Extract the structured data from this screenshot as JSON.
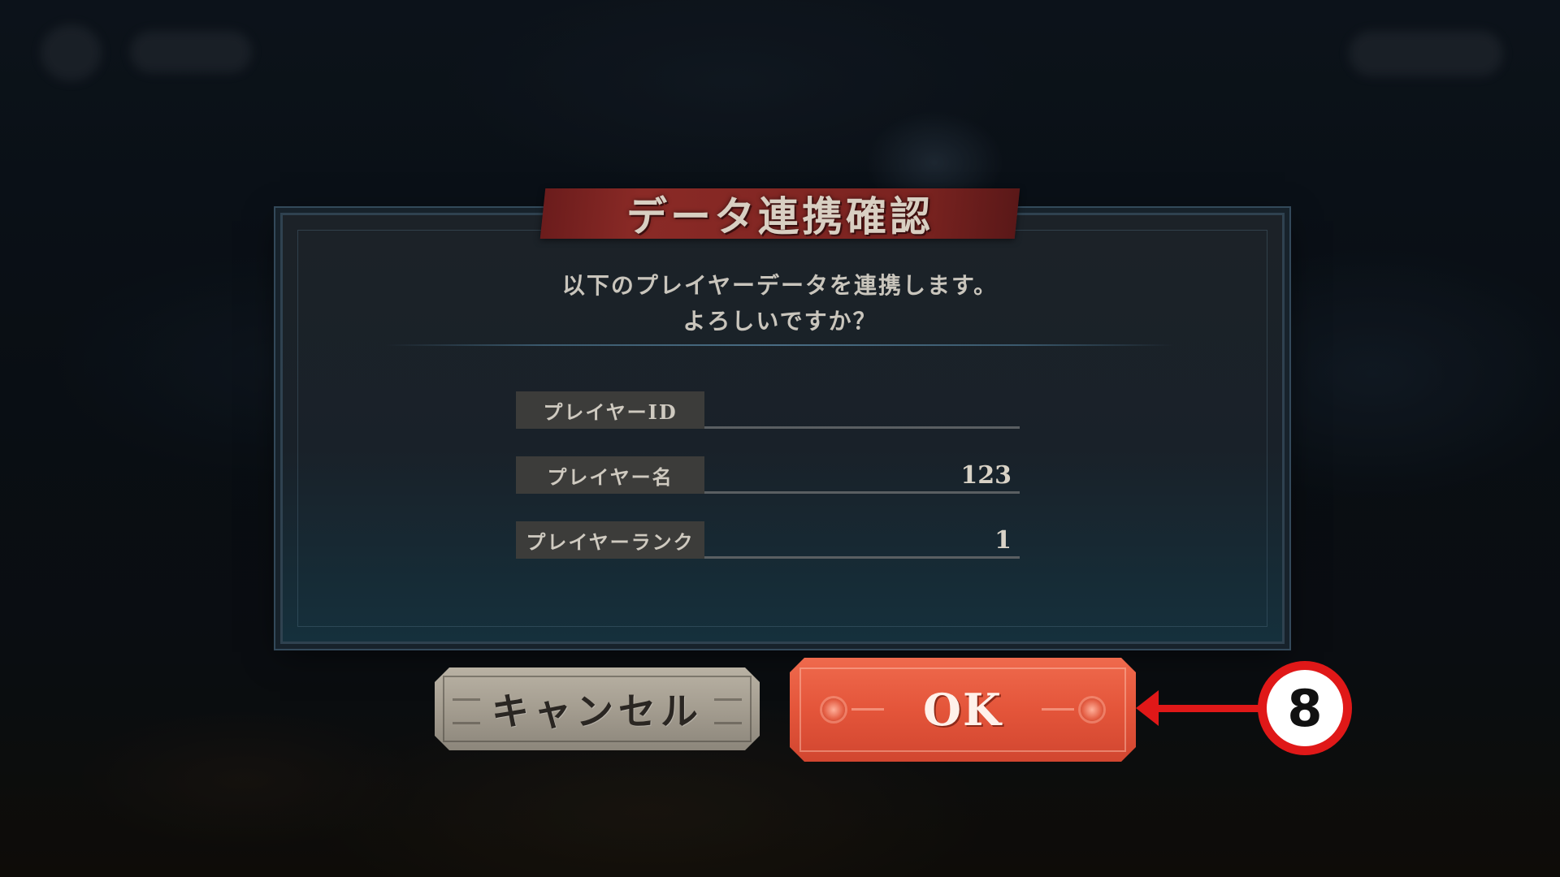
{
  "dialog": {
    "title": "データ連携確認",
    "message_line1": "以下のプレイヤーデータを連携します。",
    "message_line2": "よろしいですか？",
    "rows": [
      {
        "label": "プレイヤーID",
        "value": ""
      },
      {
        "label": "プレイヤー名",
        "value": "123"
      },
      {
        "label": "プレイヤーランク",
        "value": "1"
      }
    ]
  },
  "buttons": {
    "cancel_label": "キャンセル",
    "ok_label": "OK"
  },
  "annotation": {
    "step_number": "8",
    "color": "#e01818"
  },
  "colors": {
    "ok_button": "#e4553a",
    "cancel_button": "#a49d90",
    "title_ribbon": "#7a2320",
    "panel_bg": "#192129"
  }
}
